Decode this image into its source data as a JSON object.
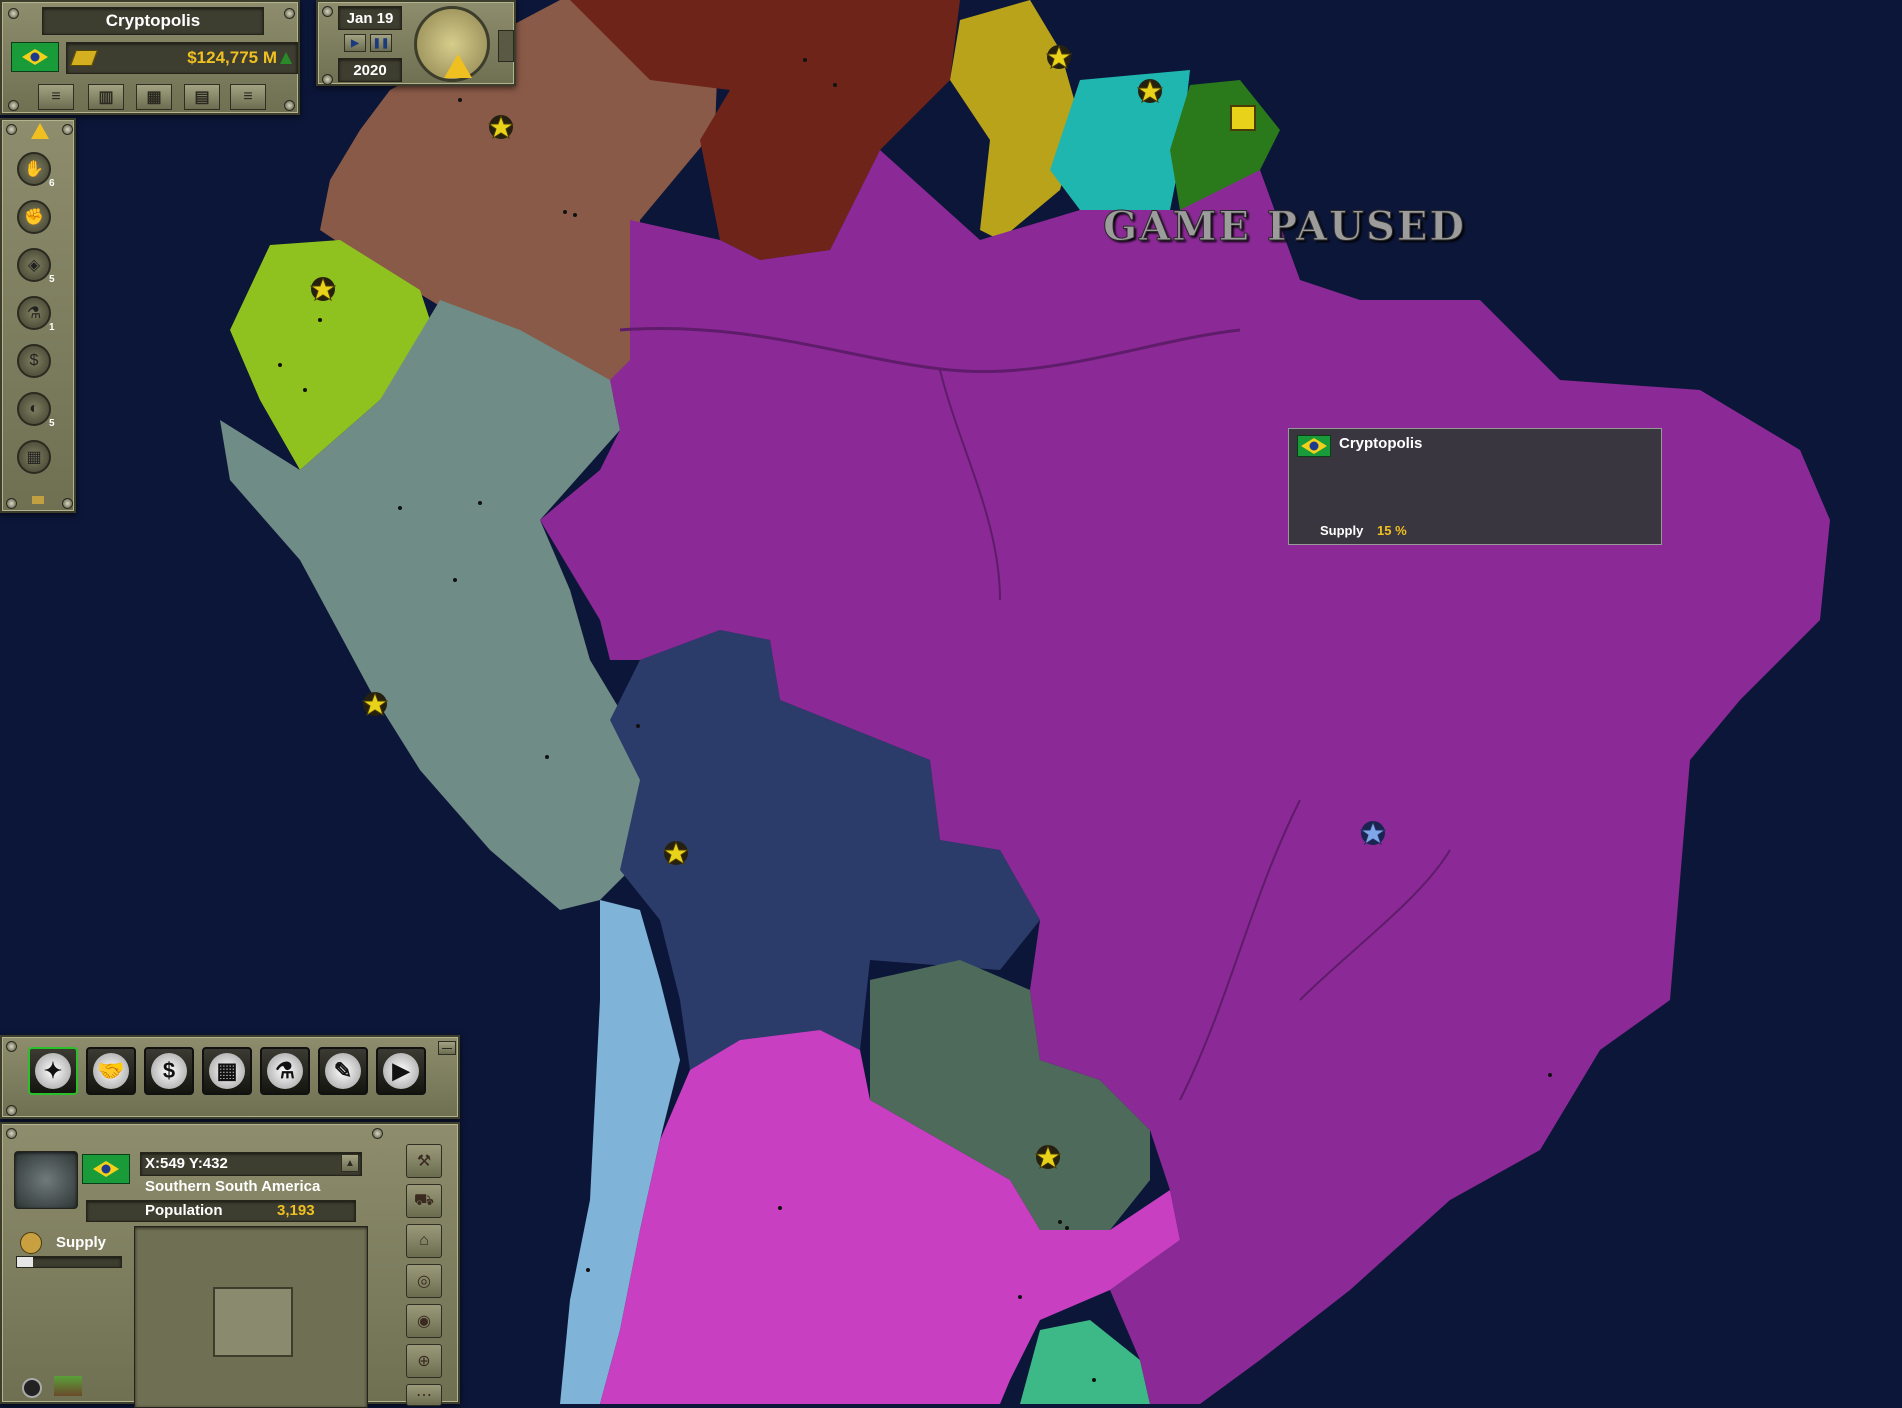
{
  "top_panel": {
    "city_name": "Cryptopolis",
    "money": "$124,775 M",
    "date": "Jan 19",
    "year": "2020"
  },
  "paused_label": "GAME PAUSED",
  "tooltip": {
    "title": "Cryptopolis",
    "supply_label": "Supply",
    "supply_value": "15 %"
  },
  "side_badges": [
    "6",
    "5",
    "1",
    "5"
  ],
  "info_panel": {
    "coords": "X:549 Y:432",
    "region": "Southern South America",
    "population_label": "Population",
    "population_value": "3,193",
    "supply_label": "Supply"
  },
  "colors": {
    "ocean": "#0c1638",
    "brazil": "#8b2a96",
    "peru": "#6f8c86",
    "bolivia": "#2b3c6b",
    "argentina": "#c83fc2",
    "colombia": "#8a5a48",
    "venezuela": "#6e2418",
    "ecuador": "#8fc21e",
    "guyana": "#b8a31a",
    "suriname": "#1fb6b0",
    "french_guiana": "#2a7a1c",
    "paraguay": "#4e6a5a",
    "chile": "#7fb3d8",
    "uruguay": "#3db887"
  }
}
